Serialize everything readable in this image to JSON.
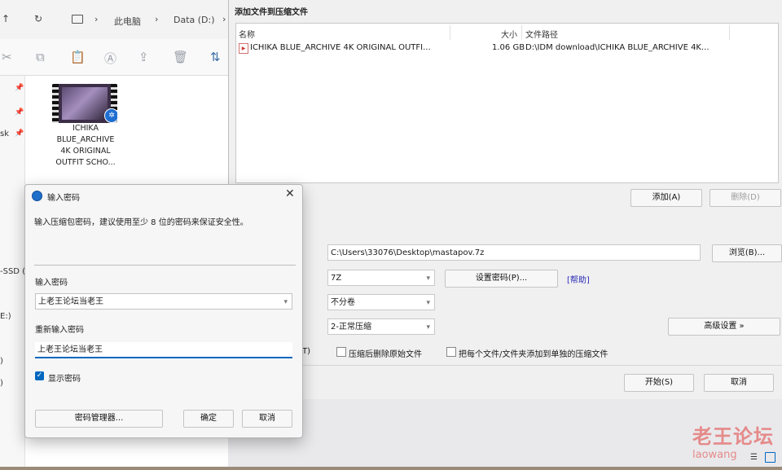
{
  "explorer": {
    "breadcrumb": [
      "此电脑",
      "Data (D:)"
    ],
    "sidebar_items": [
      "sk",
      "-SSD (",
      "E:)",
      ")",
      ")"
    ],
    "file": {
      "name_lines": [
        "ICHIKA",
        "BLUE_ARCHIVE",
        "4K ORIGINAL",
        "OUTFIT SCHO..."
      ]
    }
  },
  "archive_dialog": {
    "title": "添加文件到压缩文件",
    "columns": {
      "name": "名称",
      "size": "大小",
      "path": "文件路径"
    },
    "rows": [
      {
        "name": "ICHIKA BLUE_ARCHIVE 4K ORIGINAL OUTFI...",
        "size": "1.06 GB",
        "path": "D:\\IDM download\\ICHIKA BLUE_ARCHIVE 4K..."
      }
    ],
    "add_button": "添加(A)",
    "remove_button": "删除(D)",
    "archive_path": "C:\\Users\\33076\\Desktop\\mastapov.7z",
    "browse_button": "浏览(B)...",
    "format": "7Z",
    "set_password_button": "设置密码(P)...",
    "help_link": "[帮助]",
    "volume": "不分卷",
    "level": "2-正常压缩",
    "advanced_button": "高级设置 »",
    "option_truncated": "T)",
    "option_delete": "压缩后删除原始文件",
    "option_separate": "把每个文件/文件夹添加到单独的压缩文件",
    "start_button": "开始(S)",
    "cancel_button": "取消"
  },
  "password_dialog": {
    "title": "输入密码",
    "hint": "输入压缩包密码，建议使用至少 8 位的密码来保证安全性。",
    "password_label": "输入密码",
    "password_value": "上老王论坛当老王",
    "confirm_label": "重新输入密码",
    "confirm_value": "上老王论坛当老王",
    "show_password_label": "显示密码",
    "manager_button": "密码管理器...",
    "ok_button": "确定",
    "cancel_button": "取消"
  },
  "watermark": {
    "line1": "老王论坛",
    "line2": "laowang"
  },
  "colors": {
    "accent": "#0067c0",
    "watermark": "#e58a8a",
    "help_link": "#2b2bb8"
  }
}
